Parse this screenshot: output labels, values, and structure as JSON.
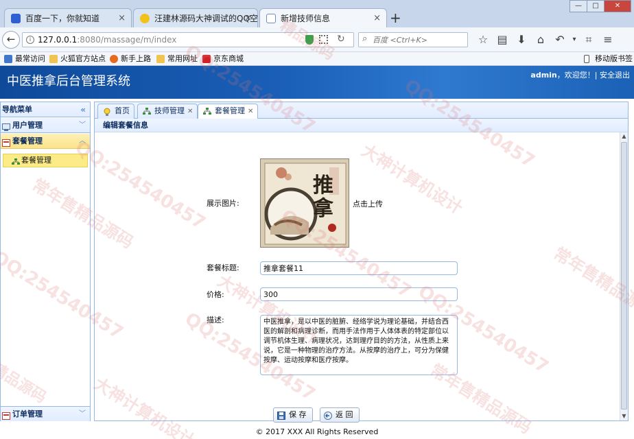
{
  "browser": {
    "tabs": [
      {
        "title": "百度一下，你就知道",
        "active": false
      },
      {
        "title": "汪建林源码大神调试的QQ空",
        "active": false
      },
      {
        "title": "新增技师信息",
        "active": true
      }
    ],
    "new_tab_glyph": "+",
    "window_buttons": [
      "—",
      "□",
      "✕"
    ],
    "url_host": "127.0.0.1",
    "url_rest": ":8080/massage/m/index",
    "search_placeholder": "百度 <Ctrl+K>",
    "bookmarks": [
      "最常访问",
      "火狐官方站点",
      "新手上路",
      "常用网址",
      "京东商城"
    ],
    "mobile_bookmarks": "移动版书签"
  },
  "app": {
    "title": "中医推拿后台管理系统",
    "user": "admin",
    "welcome": "，欢迎您！|",
    "logout": "安全退出"
  },
  "sidebar": {
    "title": "导航菜单",
    "collapse_glyph": "«",
    "groups": [
      {
        "label": "用户管理",
        "selected": false
      },
      {
        "label": "套餐管理",
        "selected": true
      },
      {
        "label": "订单管理",
        "selected": false
      }
    ],
    "active_item": "套餐管理"
  },
  "content_tabs": [
    {
      "label": "首页",
      "closable": false
    },
    {
      "label": "技师管理",
      "closable": true
    },
    {
      "label": "套餐管理",
      "closable": true,
      "active": true
    }
  ],
  "form": {
    "panel_title": "编辑套餐信息",
    "image_label": "展示图片:",
    "upload_text": "点击上传",
    "image_caption": "推拿",
    "title_label": "套餐标题:",
    "title_value": "推拿套餐11",
    "price_label": "价格:",
    "price_value": "300",
    "desc_label": "描述:",
    "desc_value": "中医推拿，是以中医的脏腑、经络学说为理论基础，并结合西医的解剖和病理诊断，而用手法作用于人体体表的特定部位以调节机体生理、病理状况，达到理疗目的的方法，从性质上来说，它是一种物理的治疗方法。从按摩的治疗上，可分为保健按摩、运动按摩和医疗按摩。",
    "save_label": "保 存",
    "back_label": "返 回"
  },
  "footer": "© 2017 XXX All Rights Reserved",
  "watermarks": [
    "QQ:254540457",
    "大神计算机设计",
    "常年售精品源码",
    "精品源码"
  ],
  "colors": {
    "header_blue": "#1a5fb8",
    "panel_border": "#95b8e7",
    "selected_yellow": "#fbec88"
  }
}
